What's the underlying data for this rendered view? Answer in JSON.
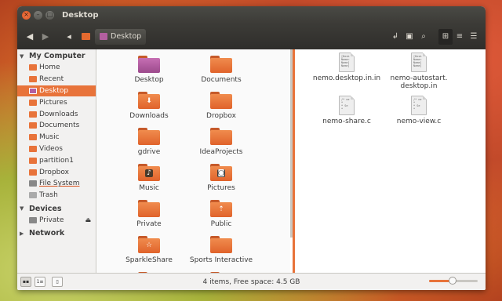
{
  "window": {
    "title": "Desktop"
  },
  "toolbar": {
    "path_label": "Desktop"
  },
  "sidebar": {
    "sections": [
      {
        "title": "My Computer",
        "items": [
          {
            "label": "Home",
            "icon": "home-folder-icon",
            "color": "#e8733a"
          },
          {
            "label": "Recent",
            "icon": "recent-folder-icon",
            "color": "#e8733a"
          },
          {
            "label": "Desktop",
            "icon": "desktop-folder-icon",
            "color": "#b35fa0",
            "active": true
          },
          {
            "label": "Pictures",
            "icon": "pictures-folder-icon",
            "color": "#e8733a"
          },
          {
            "label": "Downloads",
            "icon": "downloads-folder-icon",
            "color": "#e8733a"
          },
          {
            "label": "Documents",
            "icon": "documents-folder-icon",
            "color": "#e8733a"
          },
          {
            "label": "Music",
            "icon": "music-folder-icon",
            "color": "#e8733a"
          },
          {
            "label": "Videos",
            "icon": "videos-folder-icon",
            "color": "#e8733a"
          },
          {
            "label": "partition1",
            "icon": "folder-icon",
            "color": "#e8733a"
          },
          {
            "label": "Dropbox",
            "icon": "folder-icon",
            "color": "#e8733a"
          },
          {
            "label": "File System",
            "icon": "drive-icon",
            "color": "#888888",
            "underline": true
          },
          {
            "label": "Trash",
            "icon": "trash-icon",
            "color": "#aaaaaa"
          }
        ]
      },
      {
        "title": "Devices",
        "items": [
          {
            "label": "Private",
            "icon": "drive-icon",
            "color": "#888888",
            "eject": true
          }
        ]
      },
      {
        "title": "Network",
        "items": []
      }
    ]
  },
  "left_pane": {
    "items": [
      {
        "label": "Desktop",
        "emblem": "desktop"
      },
      {
        "label": "Documents",
        "emblem": ""
      },
      {
        "label": "Downloads",
        "emblem": "download"
      },
      {
        "label": "Dropbox",
        "emblem": ""
      },
      {
        "label": "gdrive",
        "emblem": ""
      },
      {
        "label": "IdeaProjects",
        "emblem": ""
      },
      {
        "label": "Music",
        "emblem": "music"
      },
      {
        "label": "Pictures",
        "emblem": "camera"
      },
      {
        "label": "Private",
        "emblem": ""
      },
      {
        "label": "Public",
        "emblem": "share"
      },
      {
        "label": "SparkleShare",
        "emblem": "star"
      },
      {
        "label": "Sports Interactive",
        "emblem": ""
      },
      {
        "label": "",
        "emblem": "document"
      },
      {
        "label": "",
        "emblem": ""
      }
    ]
  },
  "right_pane": {
    "files": [
      {
        "label": "nemo.desktop.in.in",
        "icon": "desktop-file-icon"
      },
      {
        "label": "nemo-autostart.\ndesktop.in",
        "icon": "desktop-file-icon"
      },
      {
        "label": "nemo-share.c",
        "icon": "c-source-file-icon"
      },
      {
        "label": "nemo-view.c",
        "icon": "c-source-file-icon"
      }
    ]
  },
  "statusbar": {
    "text": "4 items, Free space: 4.5 GB",
    "zoom_level": 0.48
  }
}
